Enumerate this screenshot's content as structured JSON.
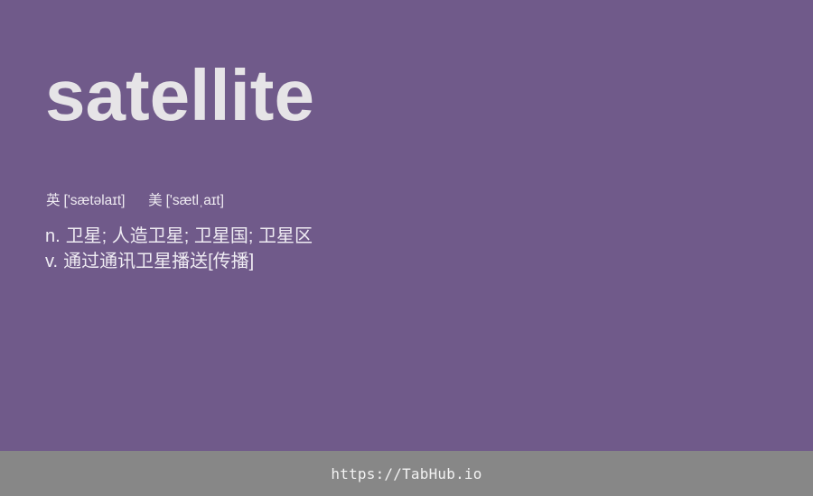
{
  "card": {
    "word": "satellite",
    "phonetics": {
      "uk": {
        "label": "英",
        "ipa": "['sætəlaɪt]"
      },
      "us": {
        "label": "美",
        "ipa": "['sætlˌaɪt]"
      }
    },
    "meanings": [
      {
        "pos": "n.",
        "text": "卫星; 人造卫星; 卫星国; 卫星区"
      },
      {
        "pos": "v.",
        "text": "通过通讯卫星播送[传播]"
      }
    ]
  },
  "footer": {
    "url": "https://TabHub.io"
  },
  "colors": {
    "background": "#705a8a",
    "footer_background": "#878787",
    "word_text": "#e6e4e7"
  }
}
